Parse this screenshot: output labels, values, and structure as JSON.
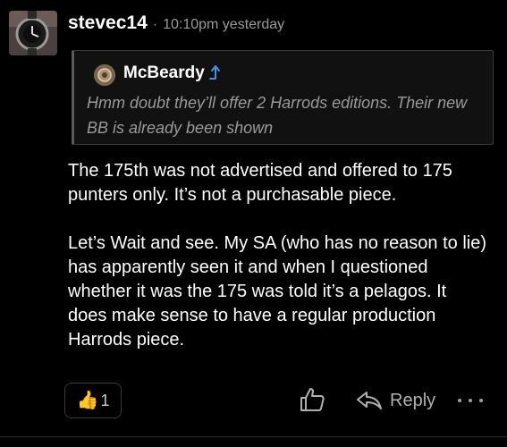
{
  "post": {
    "username": "stevec14",
    "separator": "·",
    "timestamp": "10:10pm yesterday",
    "quote": {
      "username": "McBeardy",
      "text": "Hmm doubt they’ll offer 2 Harrods editions. Their new BB is already been shown"
    },
    "paragraphs": [
      "The 175th was not advertised and offered to 175 punters only. It’s not a purchasable piece.",
      "Let’s Wait and see. My SA (who has no reason to lie) has apparently seen it and when I questioned whether it was the 175 was told it’s a pelagos. It does make sense to have a regular production Harrods piece."
    ],
    "reaction": {
      "emoji": "👍",
      "count": "1"
    },
    "actions": {
      "reply_label": "Reply"
    }
  },
  "colors": {
    "background": "#000000",
    "text": "#ffffff",
    "muted": "#9a9a9a",
    "accent_arrow": "#4a90e2"
  },
  "icons": {
    "quote_link": "arrow-up-icon",
    "like": "thumbs-up-icon",
    "reply": "reply-icon",
    "more": "ellipsis-icon"
  }
}
